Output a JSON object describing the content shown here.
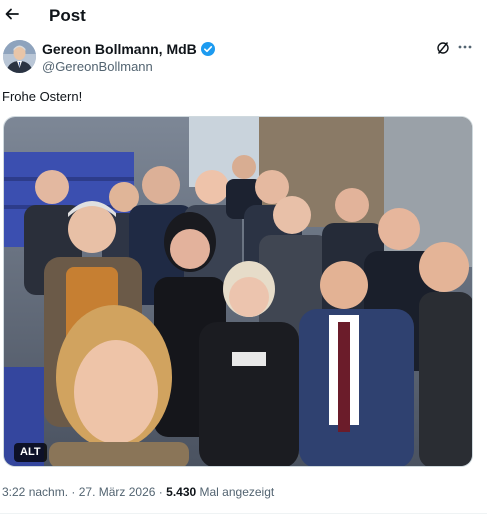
{
  "header": {
    "title": "Post",
    "back_icon": "arrow-left-icon"
  },
  "author": {
    "name": "Gereon Bollmann, MdB",
    "handle": "@GereonBollmann",
    "verified_color": "#1d9bf0"
  },
  "post": {
    "text": "Frohe Ostern!",
    "media_alt_badge": "ALT"
  },
  "meta": {
    "time": "3:22 nachm.",
    "separator": "·",
    "date": "27. März 2026",
    "views_count": "5.430",
    "views_label": "Mal angezeigt"
  },
  "icons": {
    "grok": "grok-icon",
    "more": "more-icon"
  }
}
